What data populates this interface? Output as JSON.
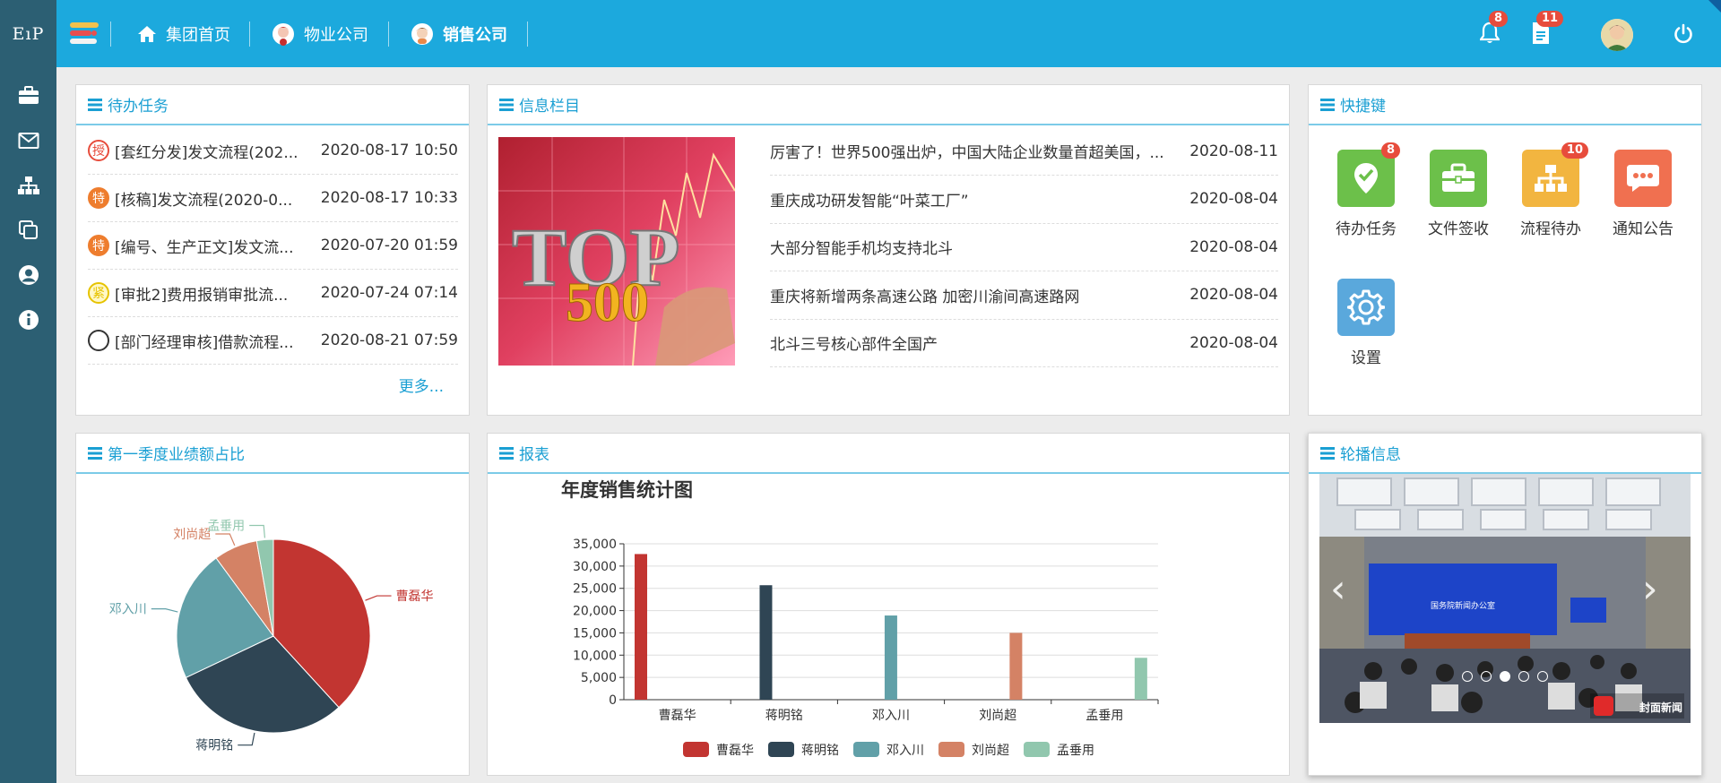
{
  "sidebar": {
    "logo": "EıP",
    "icons": [
      "briefcase-icon",
      "mail-icon",
      "org-chart-icon",
      "copy-icon",
      "user-circle-icon",
      "info-icon"
    ]
  },
  "topnav": {
    "items": [
      {
        "label": "集团首页"
      },
      {
        "label": "物业公司"
      },
      {
        "label": "销售公司"
      }
    ],
    "bell_badge": "8",
    "doc_badge": "11"
  },
  "todo": {
    "title": "待办任务",
    "more": "更多...",
    "items": [
      {
        "icon_text": "授",
        "color": "#ffffff",
        "border": "#e74c3c",
        "title": "[套红分发]发文流程(202...",
        "date": "2020-08-17 10:50"
      },
      {
        "icon_text": "特",
        "color": "#ee7d2e",
        "border": "#ee7d2e",
        "title": "[核稿]发文流程(2020-0...",
        "date": "2020-08-17 10:33"
      },
      {
        "icon_text": "特",
        "color": "#ee7d2e",
        "border": "#ee7d2e",
        "title": "[编号、生产正文]发文流...",
        "date": "2020-07-20 01:59"
      },
      {
        "icon_text": "紧",
        "color": "#fff8c8",
        "border": "#e6c300",
        "title": "[审批2]费用报销审批流...",
        "date": "2020-07-24 07:14"
      },
      {
        "icon_text": "",
        "color": "#ffffff",
        "border": "#333333",
        "title": "[部门经理审核]借款流程...",
        "date": "2020-08-21 07:59"
      }
    ]
  },
  "info": {
    "title": "信息栏目",
    "items": [
      {
        "title": "厉害了！世界500强出炉，中国大陆企业数量首超美国，...",
        "date": "2020-08-11"
      },
      {
        "title": "重庆成功研发智能“叶菜工厂”",
        "date": "2020-08-04"
      },
      {
        "title": "大部分智能手机均支持北斗",
        "date": "2020-08-04"
      },
      {
        "title": "重庆将新增两条高速公路 加密川渝间高速路网",
        "date": "2020-08-04"
      },
      {
        "title": "北斗三号核心部件全国产",
        "date": "2020-08-04"
      }
    ]
  },
  "quick": {
    "title": "快捷键",
    "items": [
      {
        "label": "待办任务",
        "color": "#6cc04a",
        "badge": "8",
        "icon": "check-badge-icon"
      },
      {
        "label": "文件签收",
        "color": "#6cc04a",
        "badge": "",
        "icon": "briefcase-icon"
      },
      {
        "label": "流程待办",
        "color": "#f2b540",
        "badge": "10",
        "icon": "org-chart-icon"
      },
      {
        "label": "通知公告",
        "color": "#f07050",
        "badge": "",
        "icon": "chat-icon"
      },
      {
        "label": "设置",
        "color": "#5aa8dc",
        "badge": "",
        "icon": "gear-icon"
      }
    ]
  },
  "pie_panel": {
    "title": "第一季度业绩额占比"
  },
  "report_panel": {
    "title": "报表"
  },
  "carousel": {
    "title": "轮播信息",
    "dots": 5,
    "active": 2,
    "caption": "国务院新闻办公室",
    "brand": "封面新闻"
  },
  "colors": {
    "accent": "#1ca9dd",
    "sidebar": "#2c5f73"
  },
  "chart_data": [
    {
      "type": "pie",
      "series": [
        {
          "name": "曹磊华",
          "value": 33000
        },
        {
          "name": "蒋明铭",
          "value": 25700
        },
        {
          "name": "邓入川",
          "value": 19000
        },
        {
          "name": "刘尚超",
          "value": 6300
        },
        {
          "name": "孟垂用",
          "value": 2400
        }
      ],
      "colors": [
        "#c23531",
        "#2f4554",
        "#61a0a8",
        "#d48265",
        "#91c7ae"
      ]
    },
    {
      "type": "bar",
      "title": "年度销售统计图",
      "categories": [
        "曹磊华",
        "蒋明铭",
        "邓入川",
        "刘尚超",
        "孟垂用"
      ],
      "values": [
        32700,
        25700,
        18900,
        15000,
        9400
      ],
      "ylim": [
        0,
        35000
      ],
      "yticks": [
        "35,000",
        "30,000",
        "25,000",
        "20,000",
        "15,000",
        "10,000",
        "5,000",
        "0"
      ],
      "legend": [
        "曹磊华",
        "蒋明铭",
        "邓入川",
        "刘尚超",
        "孟垂用"
      ],
      "colors": [
        "#c23531",
        "#2f4554",
        "#61a0a8",
        "#d48265",
        "#91c7ae"
      ]
    }
  ]
}
